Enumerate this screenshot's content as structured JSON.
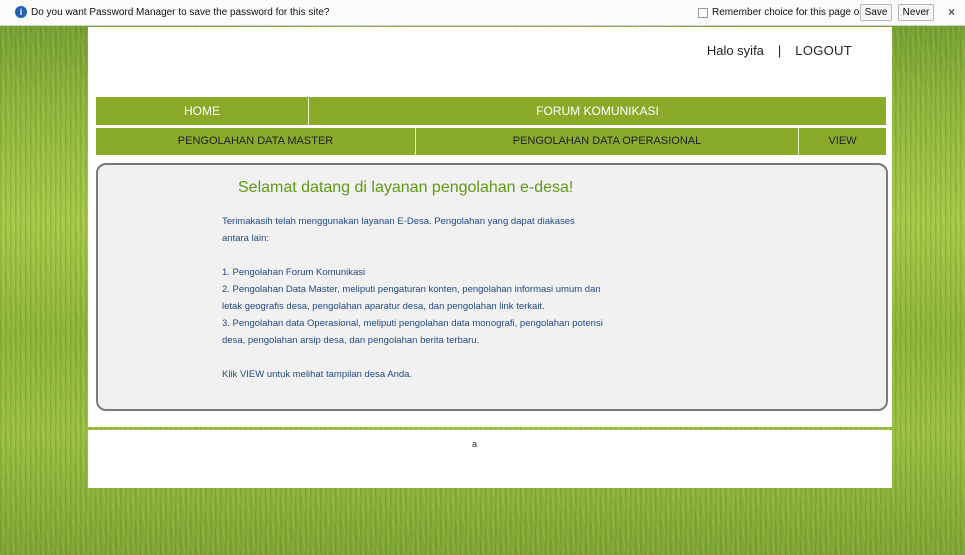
{
  "password_bar": {
    "message": "Do you want Password Manager to save the password for this site?",
    "remember_label": "Remember choice for this page only",
    "save_label": "Save",
    "never_label": "Never",
    "close_label": "×",
    "info_icon": "i"
  },
  "header": {
    "greeting": "Halo syifa",
    "separator": "|",
    "logout_label": "LOGOUT"
  },
  "nav": {
    "home": "HOME",
    "forum": "FORUM KOMUNIKASI",
    "master": "PENGOLAHAN DATA MASTER",
    "operasional": "PENGOLAHAN DATA OPERASIONAL",
    "view": "VIEW"
  },
  "content": {
    "title": "Selamat datang di layanan pengolahan e-desa!",
    "intro_line1": "Terimakasih telah menggunakan layanan E-Desa. Pengolahan yang dapat diakases",
    "intro_line2": "antara lain:",
    "item1": "1. Pengolahan Forum Komunikasi",
    "item2_line1": "2. Pengolahan Data Master, meliputi pengaturan konten, pengolahan informasi umum dan",
    "item2_line2": "letak geografis desa, pengolahan aparatur desa, dan pengolahan link terkait.",
    "item3_line1": "3. Pengolahan data Operasional, meliputi pengolahan data monografi, pengolahan potensi",
    "item3_line2": "desa, pengolahan arsip desa, dan pengolahan berita terbaru.",
    "closing": "Klik VIEW untuk melihat tampilan desa Anda."
  },
  "footer": {
    "text": "a"
  }
}
